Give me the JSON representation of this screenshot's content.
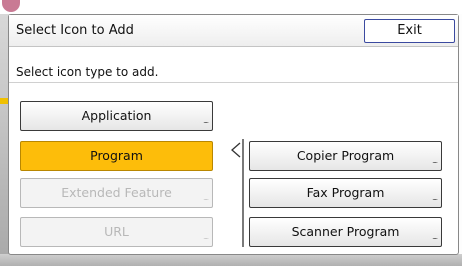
{
  "dialog": {
    "title": "Select Icon to Add",
    "exit_label": "Exit",
    "subtitle": "Select icon type to add."
  },
  "icon_types": [
    {
      "label": "Application",
      "state": "normal"
    },
    {
      "label": "Program",
      "state": "selected"
    },
    {
      "label": "Extended Feature",
      "state": "disabled"
    },
    {
      "label": "URL",
      "state": "disabled"
    }
  ],
  "programs": [
    {
      "label": "Copier Program"
    },
    {
      "label": "Fax Program"
    },
    {
      "label": "Scanner Program"
    }
  ],
  "colors": {
    "selected": "#fdbd0a",
    "exit_border": "#3b4aa0",
    "disabled_text": "#b8b8b8"
  }
}
